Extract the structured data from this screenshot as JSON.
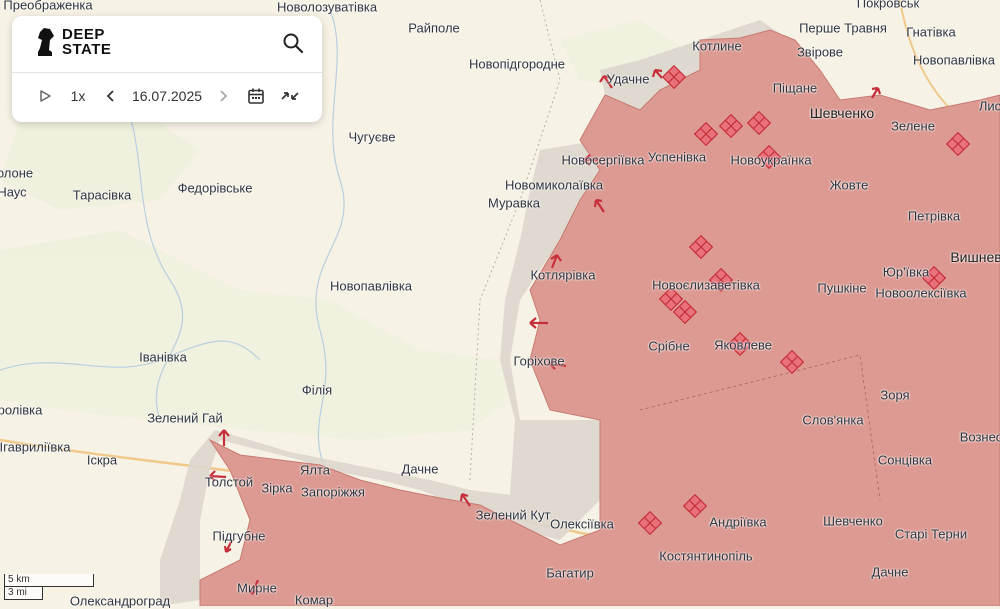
{
  "app": {
    "logo_line1": "DEEP",
    "logo_line2": "STATE"
  },
  "controls": {
    "play_icon": "play-icon",
    "speed": "1x",
    "prev_icon": "chevron-left-icon",
    "date": "16.07.2025",
    "next_icon": "chevron-right-icon",
    "calendar_icon": "calendar-icon",
    "compare_icon": "compare-arrows-icon",
    "search_icon": "search-icon"
  },
  "scale": {
    "km": "5 km",
    "mi": "3 mi"
  },
  "colors": {
    "occupied": "#dc9a92",
    "grey_zone": "#dcd6cc",
    "attack_marker": "#e0505a",
    "base": "#f7f2e6"
  },
  "places": [
    {
      "name": "Преображенка",
      "big": false
    },
    {
      "name": "Новолозуватівка",
      "big": false
    },
    {
      "name": "Покровськ",
      "big": false
    },
    {
      "name": "Райполе",
      "big": false
    },
    {
      "name": "Перше Травня",
      "big": false
    },
    {
      "name": "Гнатівка",
      "big": false
    },
    {
      "name": "Котлине",
      "big": false
    },
    {
      "name": "Звірове",
      "big": false
    },
    {
      "name": "Новопідгородне",
      "big": false
    },
    {
      "name": "Новопавлівка",
      "big": false
    },
    {
      "name": "Удачне",
      "big": false
    },
    {
      "name": "Піщане",
      "big": false
    },
    {
      "name": "Шевченко",
      "big": true
    },
    {
      "name": "Зелене",
      "big": false
    },
    {
      "name": "Чугуєве",
      "big": false
    },
    {
      "name": "Новосергіївка",
      "big": false
    },
    {
      "name": "Успенівка",
      "big": false
    },
    {
      "name": "Новоукраїнка",
      "big": false
    },
    {
      "name": "олоне",
      "big": false
    },
    {
      "name": "Наус",
      "big": false
    },
    {
      "name": "Федорівське",
      "big": false
    },
    {
      "name": "Тарасівка",
      "big": false
    },
    {
      "name": "Новомиколаївка",
      "big": false
    },
    {
      "name": "Муравка",
      "big": false
    },
    {
      "name": "Жовте",
      "big": false
    },
    {
      "name": "Петрівка",
      "big": false
    },
    {
      "name": "Вишнев",
      "big": true
    },
    {
      "name": "Котлярівка",
      "big": false
    },
    {
      "name": "Новоєлизаветівка",
      "big": false
    },
    {
      "name": "Юр'ївка",
      "big": false
    },
    {
      "name": "Пушкіне",
      "big": false
    },
    {
      "name": "Новоолексіївка",
      "big": false
    },
    {
      "name": "Новопавлівка",
      "big": false
    },
    {
      "name": "Срібне",
      "big": false
    },
    {
      "name": "Яковлеве",
      "big": false
    },
    {
      "name": "Горіхове",
      "big": false
    },
    {
      "name": "Іванівка",
      "big": false
    },
    {
      "name": "Філія",
      "big": false
    },
    {
      "name": "Зоря",
      "big": false
    },
    {
      "name": "ролівка",
      "big": false
    },
    {
      "name": "Зелений Гай",
      "big": false
    },
    {
      "name": "Слов'янка",
      "big": false
    },
    {
      "name": "Вознес",
      "big": false
    },
    {
      "name": "Ігавриліївка",
      "big": false
    },
    {
      "name": "Іскра",
      "big": false
    },
    {
      "name": "Ялта",
      "big": false
    },
    {
      "name": "Дачне",
      "big": false
    },
    {
      "name": "Сонцівка",
      "big": false
    },
    {
      "name": "Толстой",
      "big": false
    },
    {
      "name": "Зірка",
      "big": false
    },
    {
      "name": "Запоріжжя",
      "big": false
    },
    {
      "name": "Зелений Кут",
      "big": false
    },
    {
      "name": "Олексіївка",
      "big": false
    },
    {
      "name": "Андріївка",
      "big": false
    },
    {
      "name": "Шевченко",
      "big": false
    },
    {
      "name": "Старі Терни",
      "big": false
    },
    {
      "name": "Підгубне",
      "big": false
    },
    {
      "name": "Костянтинопіль",
      "big": false
    },
    {
      "name": "Багатир",
      "big": false
    },
    {
      "name": "Дачне",
      "big": false
    },
    {
      "name": "Мирне",
      "big": false
    },
    {
      "name": "Олександроград",
      "big": false
    },
    {
      "name": "Комар",
      "big": false
    },
    {
      "name": "Лис",
      "big": false
    }
  ]
}
